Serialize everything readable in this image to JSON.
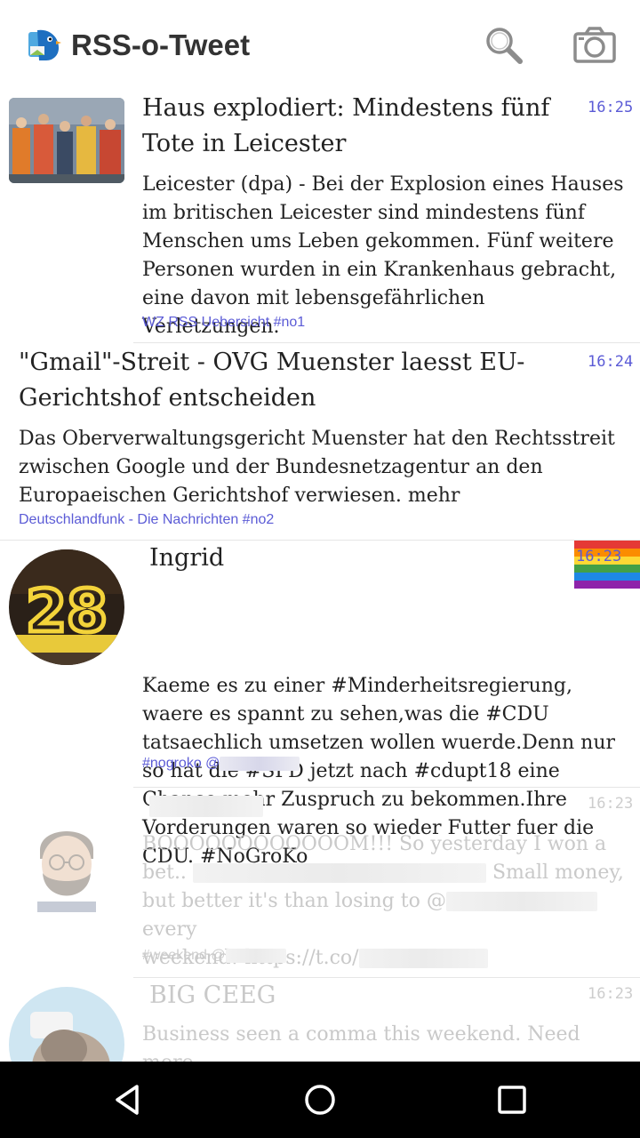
{
  "app": {
    "title": "RSS-o-Tweet",
    "logo_icon": "bird-logo-icon",
    "actions": [
      {
        "name": "search-icon"
      },
      {
        "name": "camera-icon"
      }
    ]
  },
  "feed": {
    "items": [
      {
        "kind": "news",
        "title": "Haus explodiert: Mindestens fünf Tote in Leicester",
        "time": "16:25",
        "body": "Leicester (dpa) - Bei der Explosion eines Hauses im britischen Leicester sind mindestens fünf Menschen ums Leben gekommen. Fünf weitere Personen wurden in ein Krankenhaus gebracht, eine davon mit lebensgefährlichen Verletzungen.",
        "source": "WZ RSS Uebersicht #no1"
      },
      {
        "kind": "news",
        "title": "\"Gmail\"-Streit - OVG Muenster laesst EU-Gerichtshof entscheiden",
        "time": "16:24",
        "body": "Das Oberverwaltungsgericht Muenster hat den Rechtsstreit zwischen Google und der Bundesnetzagentur an den Europaeischen Gerichtshof verwiesen. mehr",
        "source": "Deutschlandfunk - Die Nachrichten #no2"
      },
      {
        "kind": "tweet",
        "author": "Ingrid",
        "time": "16:23",
        "avatar_text": "28",
        "body": "Kaeme es zu einer #Minderheitsregierung, waere es spannt zu sehen,was die #CDU tatsaechlich umsetzen wollen wuerde.Denn nur so hat die #SPD jetzt nach #cdupt18 eine Chance mehr Zuspruch zu bekommen.Ihre Vorderungen waren so wieder Futter fuer die CDU. #NoGroKo",
        "source": "#nogroko @"
      },
      {
        "kind": "tweet",
        "time": "16:23",
        "body_line1": "BOOOOOOOOOOOOM!!! So yesterday I won a",
        "body_line2a": "bet..",
        "body_line2b": "Small money,",
        "body_line3a": "but better it's than losing to @",
        "body_line3b": "every",
        "body_line4": "weekend! https://t.co/",
        "source": "#weekend @"
      },
      {
        "kind": "tweet",
        "author": "BIG CEEG",
        "time": "16:23",
        "body": "Business seen a comma this weekend. Need more."
      }
    ]
  },
  "navbar": {
    "buttons": [
      {
        "name": "back-icon"
      },
      {
        "name": "home-icon"
      },
      {
        "name": "recents-icon"
      }
    ]
  },
  "colors": {
    "accent": "#5b5bd6",
    "text": "#222222",
    "navbar": "#000000"
  }
}
